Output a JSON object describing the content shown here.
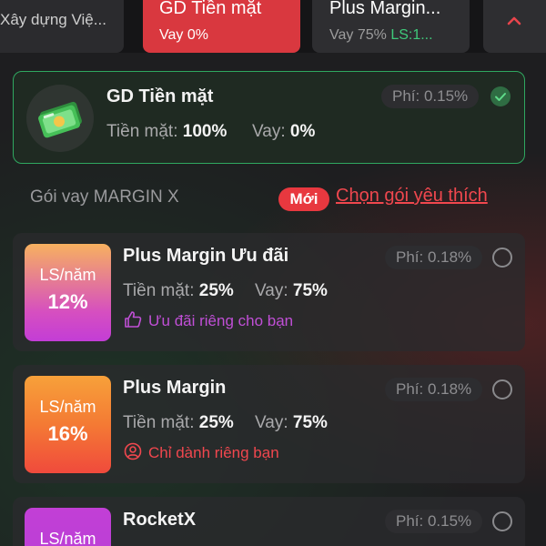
{
  "tabs": [
    {
      "title": "Xây dựng Việ..."
    },
    {
      "title": "GD Tiền mặt",
      "subtitle": "Vay 0%"
    },
    {
      "title": "Plus Margin...",
      "subtitle_prefix": "Vay 75%",
      "subtitle_rate": "LS:1..."
    }
  ],
  "cash": {
    "title": "GD Tiền mặt",
    "fee": "Phí: 0.15%",
    "cash_label": "Tiền mặt:",
    "cash_value": "100%",
    "loan_label": "Vay:",
    "loan_value": "0%"
  },
  "section": {
    "label": "Gói vay MARGIN X",
    "new_badge": "Mới",
    "pick_link": "Chọn gói yêu thích"
  },
  "packages": [
    {
      "rate_label": "LS/năm",
      "rate_value": "12%",
      "name": "Plus Margin Ưu đãi",
      "fee": "Phí: 0.18%",
      "cash_label": "Tiền mặt:",
      "cash_value": "25%",
      "loan_label": "Vay:",
      "loan_value": "75%",
      "perk": "Ưu đãi riêng cho bạn",
      "perk_color": "#c04fd6"
    },
    {
      "rate_label": "LS/năm",
      "rate_value": "16%",
      "name": "Plus Margin",
      "fee": "Phí: 0.18%",
      "cash_label": "Tiền mặt:",
      "cash_value": "25%",
      "loan_label": "Vay:",
      "loan_value": "75%",
      "perk": "Chỉ dành riêng bạn",
      "perk_color": "#f0474e"
    },
    {
      "rate_label": "LS/năm",
      "name": "RocketX",
      "fee": "Phí: 0.15%"
    }
  ],
  "colors": {
    "accent_red": "#d9383f",
    "accent_green": "#2fa860",
    "rate_12_gradient": [
      "#f7b15f",
      "#c33dd6"
    ],
    "rate_16_gradient": [
      "#f7a13a",
      "#f04a3c"
    ],
    "rate_rocket": "#b93fd6"
  },
  "icons": {
    "chevron": "chevron-up-icon",
    "money": "money-stack-icon",
    "check": "check-circle-icon",
    "thumb": "thumbs-up-icon",
    "user": "user-circle-icon"
  }
}
